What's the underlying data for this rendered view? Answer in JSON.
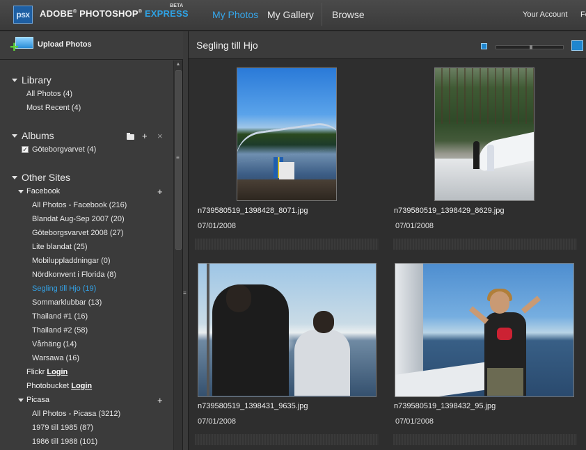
{
  "header": {
    "logo_text": "psx",
    "brand_adobe": "ADOBE",
    "brand_reg": "®",
    "brand_photoshop": "PHOTOSHOP",
    "brand_express": "EXPRESS",
    "brand_beta": "BETA",
    "nav": [
      "My Photos",
      "My Gallery",
      "Browse"
    ],
    "account": "Your Account",
    "cut_off": "Fe"
  },
  "sidebar": {
    "upload_label": "Upload Photos",
    "library": {
      "title": "Library",
      "items": [
        "All Photos (4)",
        "Most Recent (4)"
      ]
    },
    "albums": {
      "title": "Albums",
      "items": [
        "Göteborgvarvet (4)"
      ]
    },
    "other_sites": {
      "title": "Other Sites",
      "facebook": {
        "title": "Facebook",
        "items": [
          "All Photos - Facebook (216)",
          "Blandat Aug-Sep 2007 (20)",
          "Göteborgsvarvet 2008 (27)",
          "Lite blandat (25)",
          "Mobiluppladdningar (0)",
          "Nördkonvent i Florida (8)",
          "Segling till Hjo (19)",
          "Sommarklubbar (13)",
          "Thailand #1 (16)",
          "Thailand #2 (58)",
          "Vårhäng (14)",
          "Warsawa (16)"
        ]
      },
      "flickr": {
        "name": "Flickr",
        "login": "Login"
      },
      "photobucket": {
        "name": "Photobucket",
        "login": "Login"
      },
      "picasa": {
        "title": "Picasa",
        "items": [
          "All Photos - Picasa (3212)",
          "1979 till 1985 (87)",
          "1986 till 1988 (101)"
        ]
      }
    }
  },
  "main": {
    "album_title": "Segling till Hjo",
    "photos": [
      {
        "filename": "n739580519_1398428_8071.jpg",
        "date": "07/01/2008"
      },
      {
        "filename": "n739580519_1398429_8629.jpg",
        "date": "07/01/2008"
      },
      {
        "filename": "n739580519_1398431_9635.jpg",
        "date": "07/01/2008"
      },
      {
        "filename": "n739580519_1398432_95.jpg",
        "date": "07/01/2008"
      }
    ]
  },
  "colors": {
    "accent": "#36a6ea",
    "express": "#2ea3e6",
    "background": "#2e2e2e",
    "panel": "#3b3b3b"
  }
}
